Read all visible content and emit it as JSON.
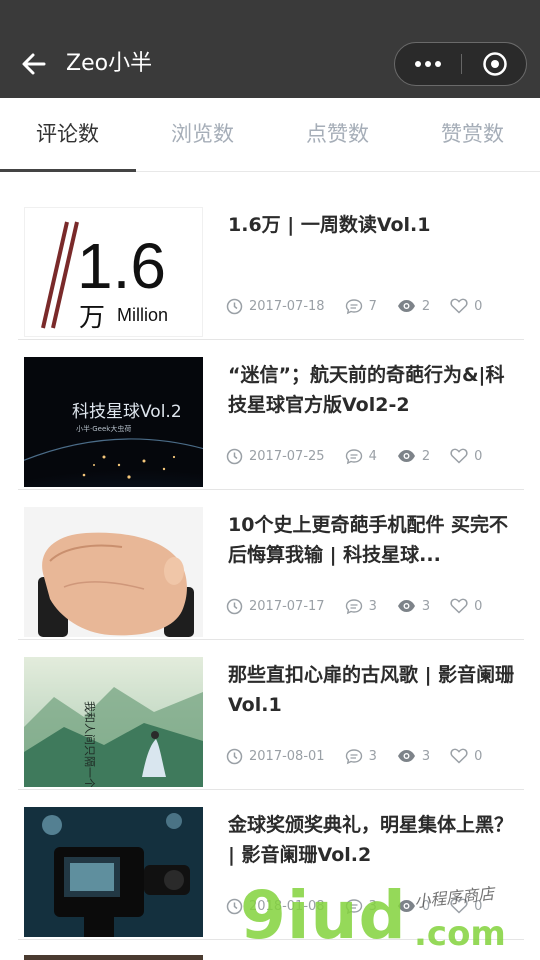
{
  "nav": {
    "title": "Zeo小半"
  },
  "tabs": [
    {
      "label": "评论数"
    },
    {
      "label": "浏览数"
    },
    {
      "label": "点赞数"
    },
    {
      "label": "赞赏数"
    }
  ],
  "articles": [
    {
      "title": "1.6万 | 一周数读Vol.1",
      "date": "2017-07-18",
      "comments": "7",
      "views": "2",
      "likes": "0",
      "thumb_text": "1.6",
      "thumb_sub1": "万",
      "thumb_sub2": "Million"
    },
    {
      "title": "“迷信”；航天前的奇葩行为&|科技星球官方版Vol2-2",
      "date": "2017-07-25",
      "comments": "4",
      "views": "2",
      "likes": "0",
      "thumb_text": "科技星球Vol.2",
      "thumb_sub1": "小半·Geek大虫荷"
    },
    {
      "title": "10个史上更奇葩手机配件 买完不后悔算我输 | 科技星球...",
      "date": "2017-07-17",
      "comments": "3",
      "views": "3",
      "likes": "0"
    },
    {
      "title": "那些直扣心扉的古风歌 | 影音阑珊Vol.1",
      "date": "2017-08-01",
      "comments": "3",
      "views": "3",
      "likes": "0",
      "thumb_text": "我和人间只隔一个你"
    },
    {
      "title": "金球奖颁奖典礼，明星集体上黑？ | 影音阑珊Vol.2",
      "date": "2018-01-08",
      "comments": "3",
      "views": "0",
      "likes": "0"
    }
  ],
  "watermark": {
    "brand": "9iud",
    "domain": ".com",
    "shop": "小程序商店"
  },
  "colors": {
    "navbar": "#3a3a3a",
    "meta_gray": "#9aa0a6",
    "active_tab": "#333333",
    "inactive_tab": "#a6aeb8"
  }
}
